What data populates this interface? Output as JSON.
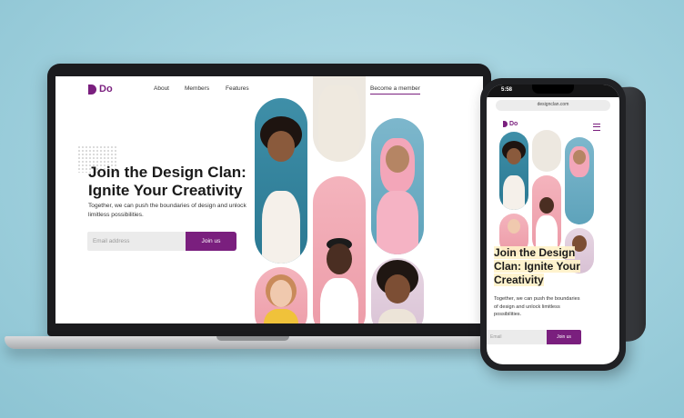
{
  "site": {
    "logo_text": "Do",
    "nav": [
      "About",
      "Members",
      "Features"
    ],
    "cta": "Become a member",
    "hero_title": "Join the Design Clan: Ignite Your Creativity",
    "hero_subtitle": "Together, we can push the boundaries of design and unlock limitless possibilities.",
    "email_placeholder": "Email address",
    "join_label": "Join us"
  },
  "phone": {
    "time": "5:58",
    "url": "designclan.com",
    "logo_text": "Do",
    "hero_title": "Join the Design Clan: Ignite Your Creativity",
    "hero_subtitle": "Together, we can push the boundaries of design and unlock limitless possibilities.",
    "email_placeholder": "Email",
    "join_label": "Join us"
  },
  "colors": {
    "brand": "#7a1f7e",
    "background": "#9fd0dd"
  }
}
